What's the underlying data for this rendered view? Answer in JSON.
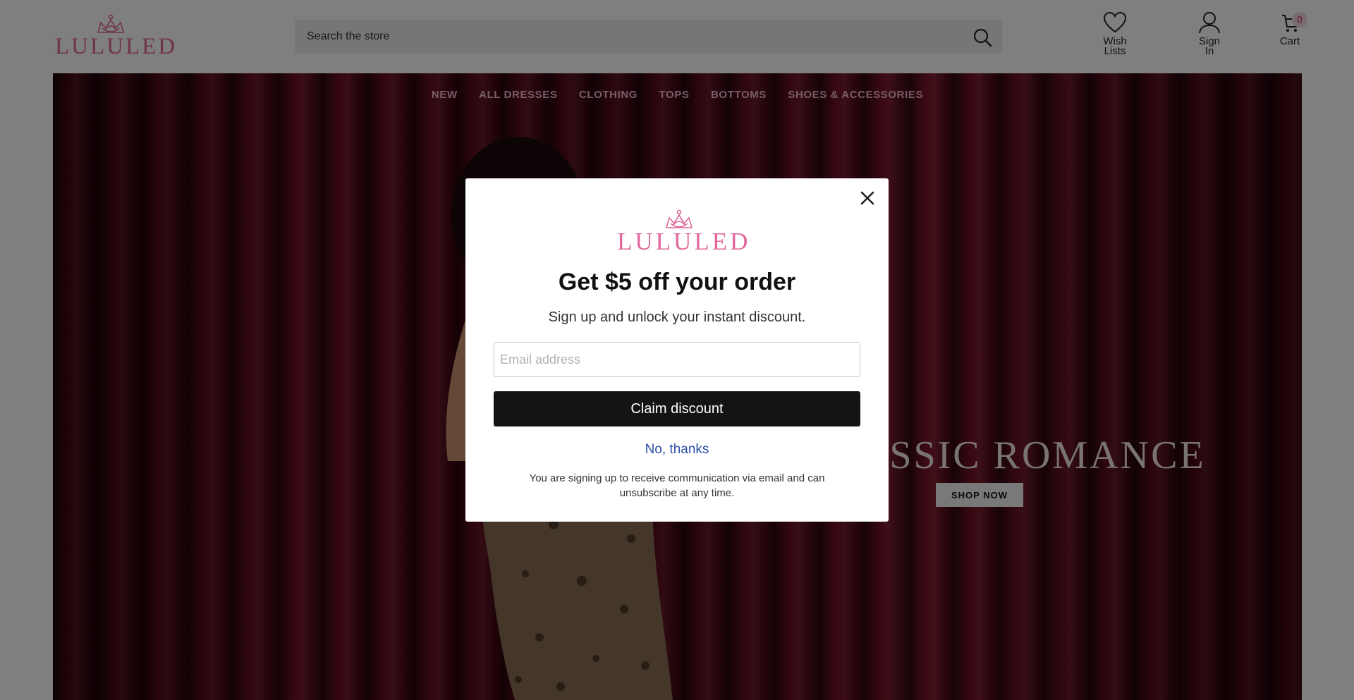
{
  "brand": {
    "logo_text": "LULULED",
    "accent_color": "#e0679a"
  },
  "search": {
    "placeholder": "Search the store"
  },
  "header": {
    "wish_label_1": "Wish",
    "wish_label_2": "Lists",
    "signin_label_1": "Sign",
    "signin_label_2": "In",
    "cart_label": "Cart",
    "cart_count": "0"
  },
  "nav": {
    "items": [
      "NEW",
      "ALL DRESSES",
      "CLOTHING",
      "TOPS",
      "BOTTOMS",
      "SHOES & ACCESSORIES"
    ]
  },
  "hero": {
    "title": "CLASSIC ROMANCE",
    "button_label": "SHOP NOW"
  },
  "popup": {
    "heading": "Get $5 off your order",
    "subheading": "Sign up and unlock your instant discount.",
    "email_placeholder": "Email address",
    "claim_label": "Claim discount",
    "decline_label": "No, thanks",
    "disclaimer": "You are signing up to receive communication via email and can unsubscribe at any time."
  },
  "icons": [
    "search-icon",
    "heart-icon",
    "user-icon",
    "cart-icon",
    "close-icon",
    "crown-icon"
  ]
}
